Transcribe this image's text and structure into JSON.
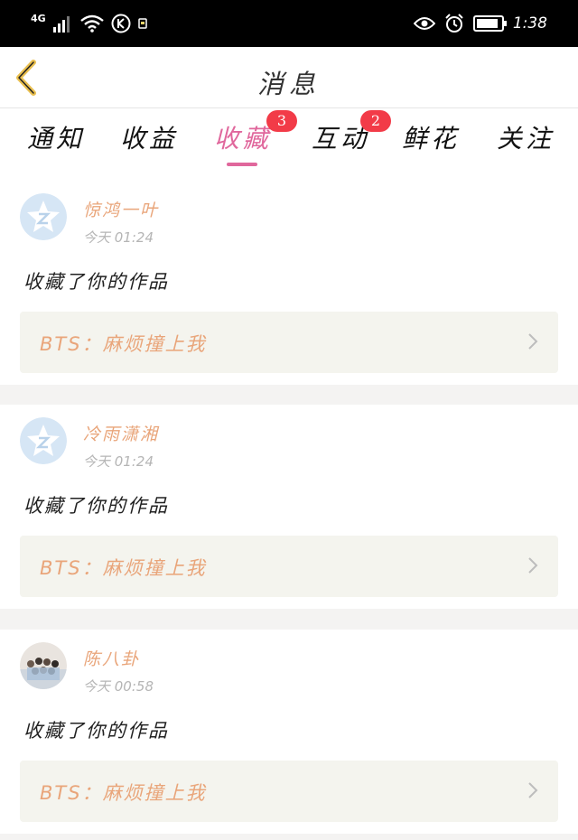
{
  "status_bar": {
    "network": "4G",
    "time": "1:38",
    "battery_level": 0.76,
    "icons": [
      "signal-icon",
      "wifi-icon",
      "k-icon",
      "notification-icon",
      "eye-icon",
      "alarm-icon",
      "battery-icon"
    ]
  },
  "header": {
    "title": "消息",
    "back_icon": "chevron-left-icon"
  },
  "tabs": [
    {
      "label": "通知",
      "badge": ""
    },
    {
      "label": "收益",
      "badge": ""
    },
    {
      "label": "收藏",
      "badge": "3",
      "active": true
    },
    {
      "label": "互动",
      "badge": "2"
    },
    {
      "label": "鲜花",
      "badge": ""
    },
    {
      "label": "关注",
      "badge": ""
    }
  ],
  "notifications": [
    {
      "username": "惊鸿一叶",
      "time": "今天 01:24",
      "action": "收藏了你的作品",
      "work_title": "BTS：麻烦撞上我",
      "avatar": "default-avatar-icon"
    },
    {
      "username": "冷雨潇湘",
      "time": "今天 01:24",
      "action": "收藏了你的作品",
      "work_title": "BTS：麻烦撞上我",
      "avatar": "default-avatar-icon"
    },
    {
      "username": "陈八卦",
      "time": "今天 00:58",
      "action": "收藏了你的作品",
      "work_title": "BTS：麻烦撞上我",
      "avatar": "photo-avatar"
    }
  ],
  "colors": {
    "accent": "#e0679c",
    "badge": "#f23b48",
    "username": "#e9a57a",
    "link_bg": "#f4f4ee"
  }
}
